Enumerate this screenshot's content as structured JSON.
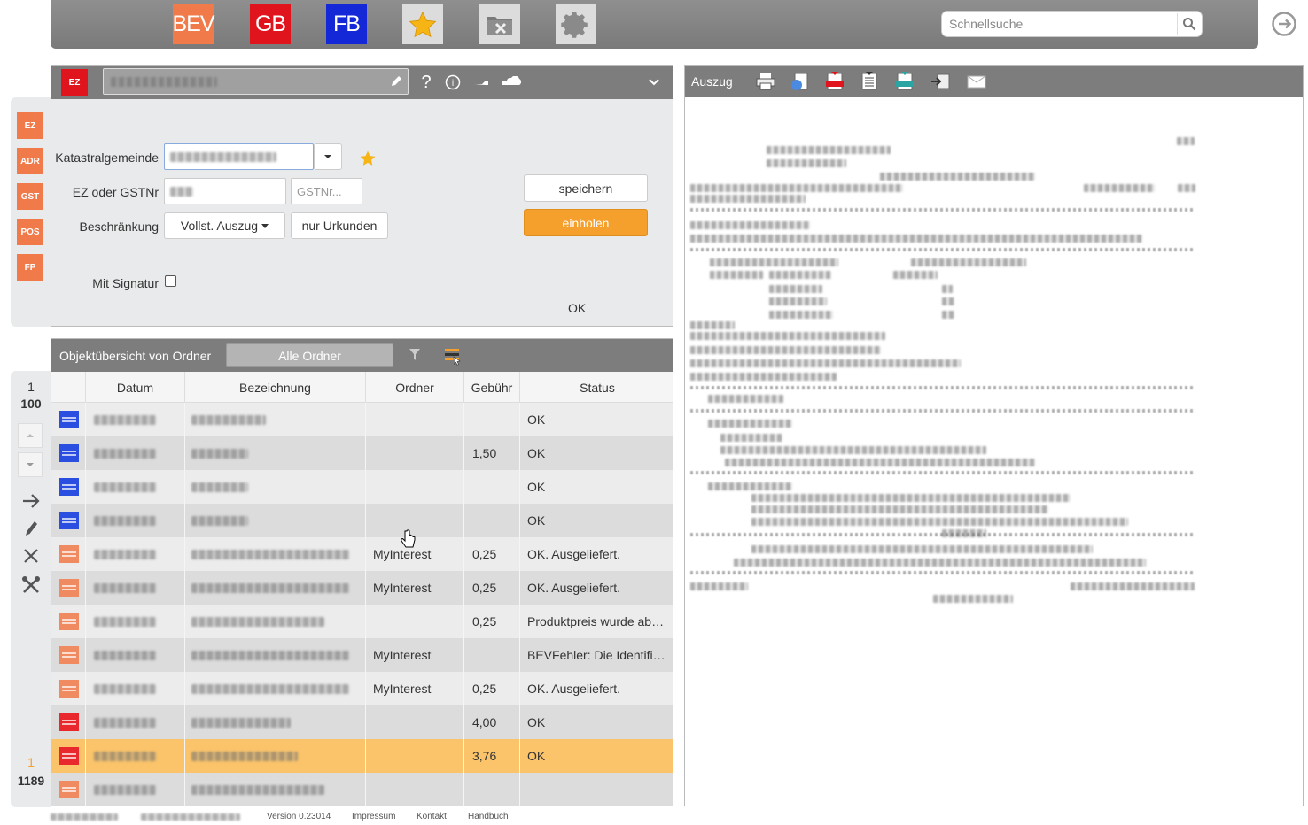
{
  "topbar": {
    "bev_label": "BEV",
    "gb_label": "GB",
    "fb_label": "FB",
    "search_placeholder": "Schnellsuche"
  },
  "side_tabs": [
    "EZ",
    "ADR",
    "GST",
    "POS",
    "FP"
  ],
  "form": {
    "badge": "EZ",
    "labels": {
      "katastralgemeinde": "Katastralgemeinde",
      "ez_gstnr": "EZ oder GSTNr",
      "beschraenkung": "Beschränkung",
      "mit_signatur": "Mit Signatur"
    },
    "gstnr_placeholder": "GSTNr...",
    "auszug_select": "Vollst. Auszug",
    "nur_urkunden": "nur Urkunden",
    "speichern": "speichern",
    "einholen": "einholen",
    "status": "OK",
    "header_help": "?",
    "header_info": "i"
  },
  "table": {
    "title": "Objektübersicht von Ordner",
    "folder_dropdown": "Alle Ordner",
    "columns": [
      "Datum",
      "Bezeichnung",
      "Ordner",
      "Gebühr",
      "Status"
    ],
    "rows": [
      {
        "ordner": "",
        "gebuehr": "",
        "status": "OK",
        "icon_color": "#2a4fe0",
        "style": "odd"
      },
      {
        "ordner": "",
        "gebuehr": "1,50",
        "status": "OK",
        "icon_color": "#2a4fe0",
        "style": "even"
      },
      {
        "ordner": "",
        "gebuehr": "",
        "status": "OK",
        "icon_color": "#2a4fe0",
        "style": "odd"
      },
      {
        "ordner": "",
        "gebuehr": "",
        "status": "OK",
        "icon_color": "#2a4fe0",
        "style": "even"
      },
      {
        "ordner": "MyInterest",
        "gebuehr": "0,25",
        "status": "OK. Ausgeliefert.",
        "icon_color": "#f08a60",
        "style": "odd"
      },
      {
        "ordner": "MyInterest",
        "gebuehr": "0,25",
        "status": "OK. Ausgeliefert.",
        "icon_color": "#f08a60",
        "style": "even"
      },
      {
        "ordner": "",
        "gebuehr": "0,25",
        "status": "Produktpreis wurde ab…",
        "icon_color": "#f08a60",
        "style": "odd"
      },
      {
        "ordner": "MyInterest",
        "gebuehr": "",
        "status": "BEVFehler: Die Identifi…",
        "icon_color": "#f08a60",
        "style": "even"
      },
      {
        "ordner": "MyInterest",
        "gebuehr": "0,25",
        "status": "OK. Ausgeliefert.",
        "icon_color": "#f08a60",
        "style": "odd"
      },
      {
        "ordner": "",
        "gebuehr": "4,00",
        "status": "OK",
        "icon_color": "#e8282c",
        "style": "even"
      },
      {
        "ordner": "",
        "gebuehr": "3,76",
        "status": "OK",
        "icon_color": "#e8282c",
        "style": "sel"
      },
      {
        "ordner": "",
        "gebuehr": "",
        "status": "",
        "icon_color": "#f08a60",
        "style": "even"
      }
    ]
  },
  "nav": {
    "page_top": "1",
    "page_size": "100",
    "current": "1",
    "total": "1189"
  },
  "auszug": {
    "title": "Auszug"
  },
  "footer": {
    "version": "Version 0.23014",
    "impressum": "Impressum",
    "kontakt": "Kontakt",
    "handbuch": "Handbuch"
  },
  "colors": {
    "orange_accent": "#f5a02c",
    "header_gray": "#7d7d7d",
    "bev": "#f07a4a",
    "gb": "#e0141c",
    "fb": "#1428d8"
  }
}
